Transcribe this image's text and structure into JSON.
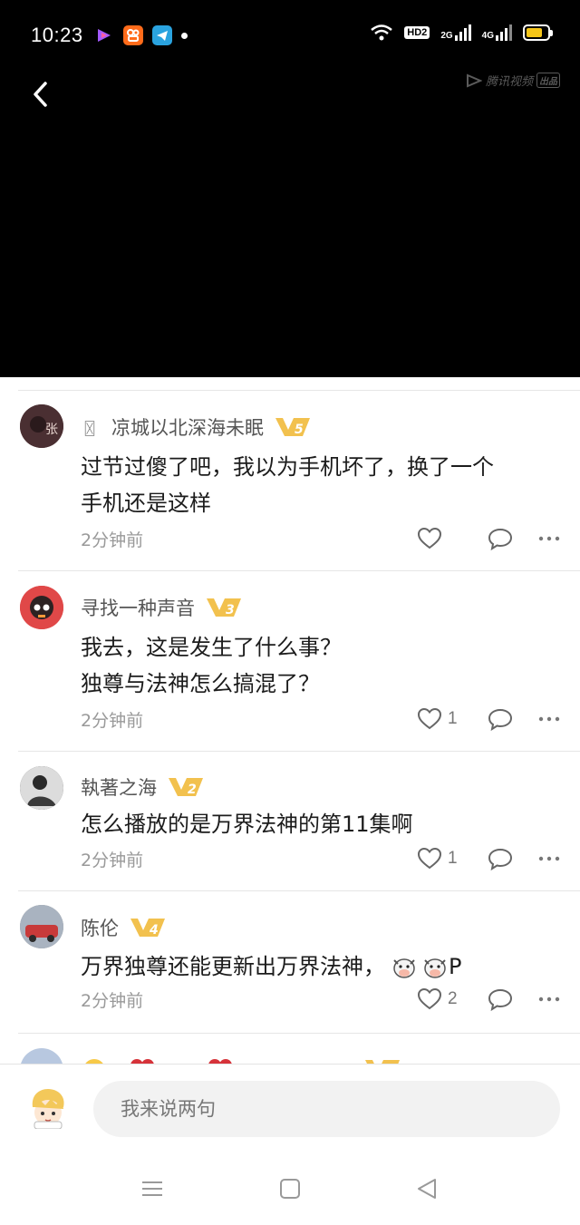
{
  "status_bar": {
    "time": "10:23",
    "hd_label": "HD2",
    "net_2g": "2G",
    "net_4g": "4G"
  },
  "video": {
    "watermark_text": "腾讯视频",
    "watermark_badge": "出品"
  },
  "comments": [
    {
      "name_prefix": "〿",
      "username": "凉城以北深海未眠",
      "vip_level": "5",
      "text_lines": [
        "过节过傻了吧，我以为手机坏了，换了一个",
        "手机还是这样"
      ],
      "time": "2分钟前",
      "like_count": ""
    },
    {
      "username": "寻找一种声音",
      "vip_level": "3",
      "text_lines": [
        "我去，这是发生了什么事？",
        "独尊与法神怎么搞混了？"
      ],
      "time": "2分钟前",
      "like_count": "1"
    },
    {
      "username": "執著之海",
      "vip_level": "2",
      "text_lines": [
        "怎么播放的是万界法神的第11集啊"
      ],
      "time": "2分钟前",
      "like_count": "1"
    },
    {
      "username": "陈伦",
      "vip_level": "4",
      "text_lines": [
        "万界独尊还能更新出万界法神，"
      ],
      "text_suffix": "P",
      "time": "2分钟前",
      "like_count": "2"
    }
  ],
  "input_bar": {
    "placeholder": "我来说两句"
  },
  "colors": {
    "vip_gold": "#f2c14e",
    "vip_gold_dark": "#d99a1e",
    "battery_yellow": "#f5c518"
  },
  "icons": {
    "like": "heart-icon",
    "reply": "comment-bubble-icon",
    "more": "more-dots-icon",
    "back": "chevron-left-icon"
  }
}
